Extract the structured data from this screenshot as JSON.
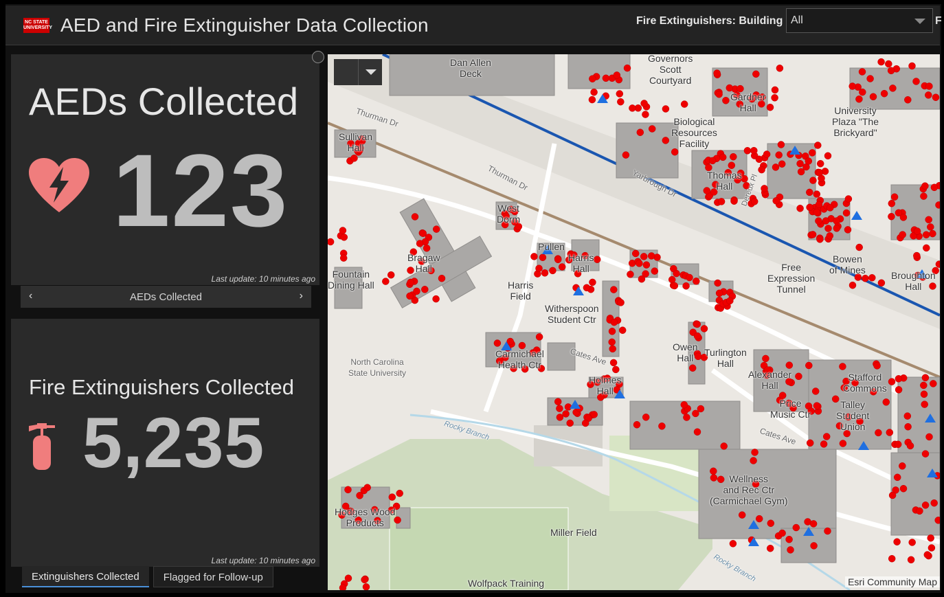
{
  "header": {
    "logo_text": "NC STATE UNIVERSITY",
    "title": "AED and Fire Extinguisher Data Collection",
    "filter_label": "Fire Extinguishers: Building",
    "filter_value": "All",
    "filter_trailing": "F"
  },
  "aed_card": {
    "title": "AEDs Collected",
    "value": "123",
    "last_update": "Last update: 10 minutes ago",
    "icon": "heart-defibrillator-icon",
    "nav_label": "AEDs Collected"
  },
  "fe_card": {
    "title": "Fire Extinguishers Collected",
    "value": "5,235",
    "last_update": "Last update: 10 minutes ago",
    "icon": "fire-extinguisher-icon"
  },
  "tabs": [
    "Extinguishers Collected",
    "Flagged for Follow-up"
  ],
  "map": {
    "labels": {
      "dan_allen": "Dan Allen\nDeck",
      "governors": "Governors\nScott\nCourtyard",
      "gardner": "Gardner\nHall",
      "biological": "Biological\nResources\nFacility",
      "university_plaza": "University\nPlaza \"The\nBrickyard\"",
      "thomas": "Thomas\nHall",
      "sullivan": "Sullivan\nHall",
      "bragaw": "Bragaw\nHall",
      "west": "West\nDorm",
      "pullen": "Pullen",
      "harris_hall": "Harris\nHall",
      "harris_field": "Harris\nField",
      "witherspoon": "Witherspoon\nStudent Ctr",
      "carmichael_health": "Carmichael\nHealth Ctr",
      "holmes": "Holmes\nHall",
      "owen": "Owen\nHall",
      "turlington": "Turlington\nHall",
      "free_expression": "Free\nExpression\nTunnel",
      "alexander": "Alexander\nHall",
      "stafford": "Stafford\nCommons",
      "price": "Price\nMusic Ctr",
      "talley": "Talley\nStudent\nUnion",
      "wellness": "Wellness\nand Rec Ctr\n(Carmichael Gym)",
      "miller": "Miller Field",
      "hodges": "Hodges Wood\nProducts",
      "wolfpack": "Wolfpack Training",
      "ncsu": "North Carolina\nState University",
      "fountain": "Fountain\nDining Hall",
      "bowen": "Bowen\nof Mines",
      "broughton": "Broughton\nHall",
      "thurman1": "Thurman Dr",
      "thurman2": "Thurman Dr",
      "yarbrough": "Yarbrough Dr",
      "cates1": "Cates Ave",
      "cates2": "Cates Ave",
      "rocky1": "Rocky Branch",
      "rocky2": "Rocky Branch",
      "dereux": "Dereux Pl"
    },
    "attribution": "Esri Community Map",
    "colors": {
      "point": "#ee0000",
      "aed": "#1f6fe0",
      "road_boundary": "#1a56b0"
    }
  }
}
